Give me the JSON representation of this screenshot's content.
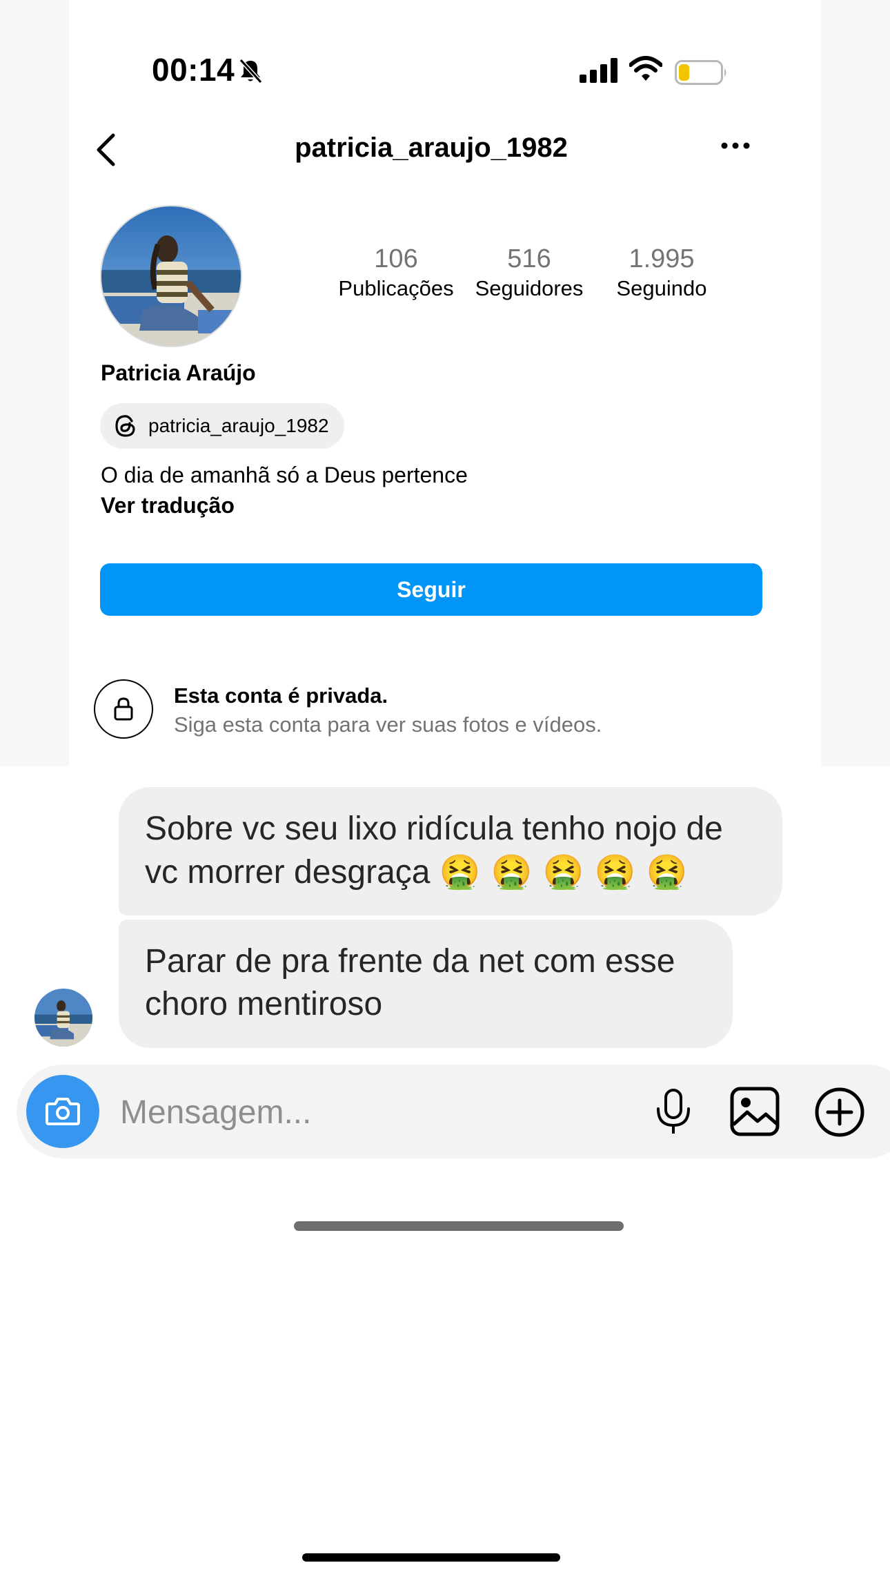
{
  "status_bar": {
    "time": "00:14"
  },
  "header": {
    "username": "patricia_araujo_1982"
  },
  "profile": {
    "stats": [
      {
        "value": "106",
        "label": "Publicações"
      },
      {
        "value": "516",
        "label": "Seguidores"
      },
      {
        "value": "1.995",
        "label": "Seguindo"
      }
    ],
    "display_name": "Patricia Araújo",
    "threads_handle": "patricia_araujo_1982",
    "bio": "O dia de amanhã só a Deus pertence",
    "translate_link": "Ver tradução",
    "follow_button": "Seguir",
    "private_title": "Esta conta é privada.",
    "private_subtitle": "Siga esta conta para ver suas fotos e vídeos."
  },
  "messages": [
    {
      "text": "Sobre vc seu lixo ridícula tenho nojo de vc morrer desgraça",
      "emoji": "🤮 🤮 🤮 🤮 🤮"
    },
    {
      "text": "Parar de pra frente da net com esse choro mentiroso"
    }
  ],
  "composer": {
    "placeholder": "Mensagem..."
  },
  "icons": {
    "bell": "bell-slash-icon",
    "signal": "cellular-signal-icon",
    "wifi": "wifi-icon",
    "battery": "battery-icon",
    "back": "chevron-left-icon",
    "more": "more-horizontal-icon",
    "threads": "threads-icon",
    "lock": "lock-icon",
    "camera": "camera-icon",
    "mic": "microphone-icon",
    "gallery": "image-icon",
    "plus": "plus-circle-icon"
  },
  "colors": {
    "follow_button": "#0095f6",
    "camera_button": "#3797f0",
    "bubble": "#efefef",
    "battery_level": "#f5c400"
  },
  "battery_level": 0.25
}
